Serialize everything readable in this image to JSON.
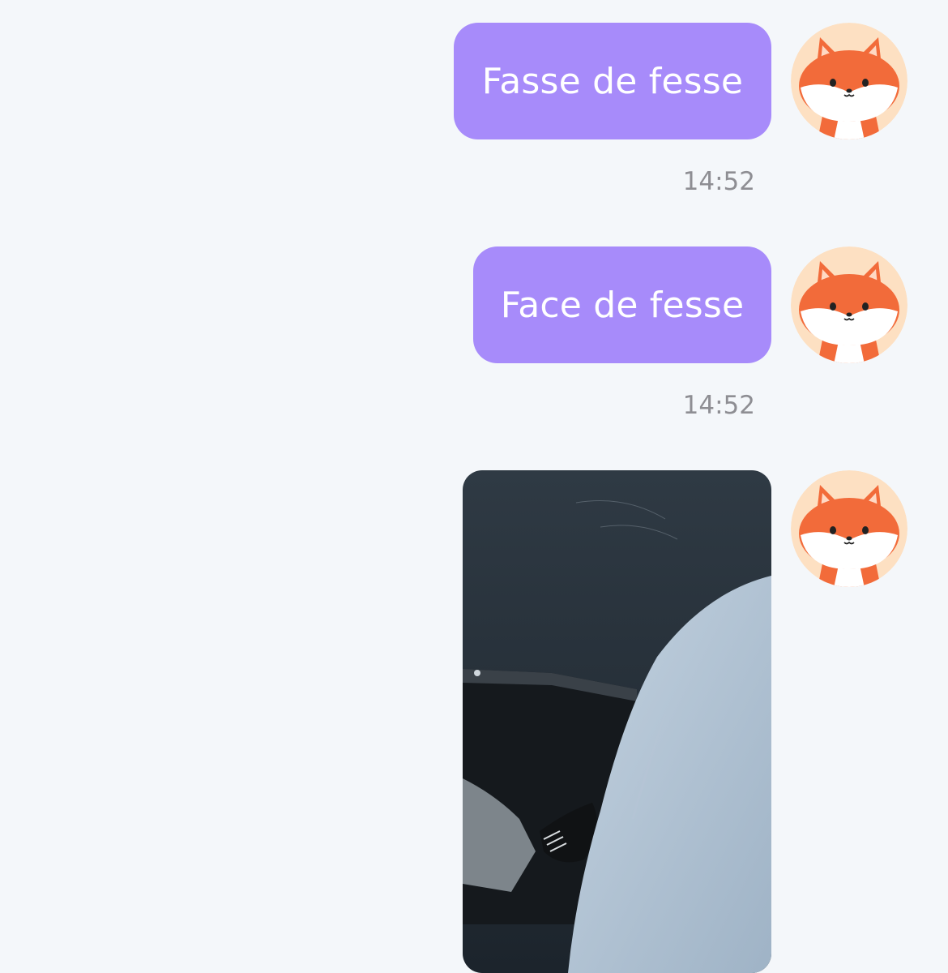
{
  "messages": [
    {
      "text": "Fasse de fesse",
      "time": "14:52"
    },
    {
      "text": "Face de fesse",
      "time": "14:52"
    },
    {
      "image_alt": "photo"
    }
  ],
  "avatar": {
    "icon": "fox-avatar-icon"
  },
  "colors": {
    "background": "#f4f7fa",
    "bubble": "#a78bfa",
    "bubble_text": "#ffffff",
    "timestamp": "#8e8e93",
    "avatar_bg": "#fde0c2",
    "fox_orange": "#f26b3a"
  }
}
